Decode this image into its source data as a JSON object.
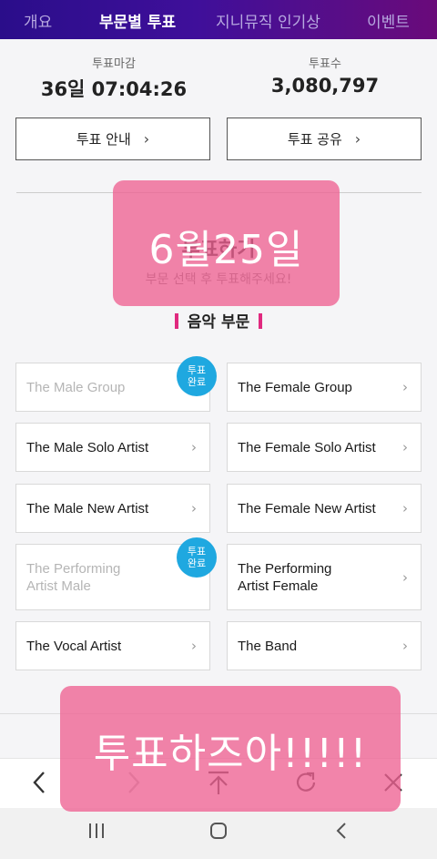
{
  "nav": {
    "tabs": [
      {
        "label": "개요"
      },
      {
        "label": "부문별 투표"
      },
      {
        "label": "지니뮤직 인기상"
      },
      {
        "label": "이벤트"
      }
    ]
  },
  "stats": {
    "deadline_label": "투표마감",
    "deadline_value": "36일 07:04:26",
    "votes_label": "투표수",
    "votes_value": "3,080,797"
  },
  "buttons": {
    "guide": "투표 안내",
    "share": "투표 공유"
  },
  "vote": {
    "title": "투표하기",
    "subtitle": "부문 선택 후 투표해주세요!"
  },
  "section": {
    "title": "음악 부문"
  },
  "categories": [
    {
      "name": "The Male Group",
      "done": true
    },
    {
      "name": "The Female Group",
      "done": false
    },
    {
      "name": "The Male Solo Artist",
      "done": false
    },
    {
      "name": "The Female Solo Artist",
      "done": false
    },
    {
      "name": "The Male New Artist",
      "done": false
    },
    {
      "name": "The Female New Artist",
      "done": false
    },
    {
      "name": "The Performing Artist Male",
      "done": true
    },
    {
      "name": "The Performing Artist Female",
      "done": false
    },
    {
      "name": "The Vocal Artist",
      "done": false
    },
    {
      "name": "The Band",
      "done": false
    }
  ],
  "badge": {
    "line1": "투표",
    "line2": "완료"
  },
  "stickers": {
    "top": "6월25일",
    "bottom": "투표하즈아!!!!!"
  },
  "colors": {
    "nav_bg": "#3f0f9a",
    "accent_pink": "#e0297f",
    "badge_blue": "#1fa8e0",
    "sticker_pink": "#ee6292"
  },
  "icons": {
    "back": "chevron-left-icon",
    "forward": "chevron-right-icon",
    "top": "arrow-up-icon",
    "refresh": "refresh-icon",
    "close": "close-icon"
  }
}
